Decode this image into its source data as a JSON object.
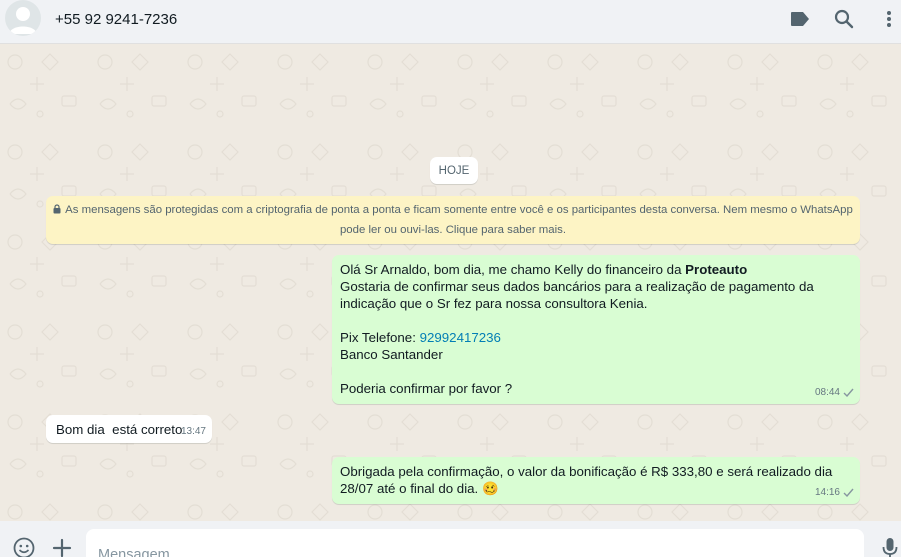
{
  "header": {
    "contact_name": "+55 92 9241-7236",
    "icons": [
      "label-icon",
      "search-icon",
      "menu-icon"
    ]
  },
  "chat": {
    "date_label": "HOJE",
    "encryption_notice": "As mensagens são protegidas com a criptografia de ponta a ponta e ficam somente entre você e os participantes desta conversa. Nem mesmo o WhatsApp pode ler ou ouvi-las. Clique para saber mais.",
    "messages": [
      {
        "direction": "out",
        "greeting": "Olá Sr Arnaldo, bom dia, me chamo Kelly do financeiro da ",
        "company": "Proteauto",
        "body": "Gostaria de confirmar seus dados bancários para a realização de pagamento da indicação que o Sr fez para nossa consultora Kenia.",
        "pix_label": "Pix Telefone: ",
        "pix_number": "92992417236",
        "bank": "Banco Santander",
        "closing": "Poderia confirmar por favor ?",
        "time": "08:44",
        "status": "sent"
      },
      {
        "direction": "in",
        "text": "Bom dia  está correto",
        "time": "13:47"
      },
      {
        "direction": "out",
        "text": "Obrigada pela confirmação, o valor da bonificação é R$ 333,80 e será realizado dia 28/07 até o final do dia.",
        "emoji": "🥴",
        "time": "14:16",
        "status": "sent"
      }
    ]
  },
  "footer": {
    "placeholder": "Mensagem",
    "icons": [
      "emoji-icon",
      "attach-plus-icon",
      "microphone-icon"
    ]
  },
  "colors": {
    "outgoing_bubble": "#d9fdd3",
    "incoming_bubble": "#ffffff",
    "notice_bg": "#fdf4c5",
    "chat_bg": "#efeae2",
    "link": "#027eb5"
  }
}
